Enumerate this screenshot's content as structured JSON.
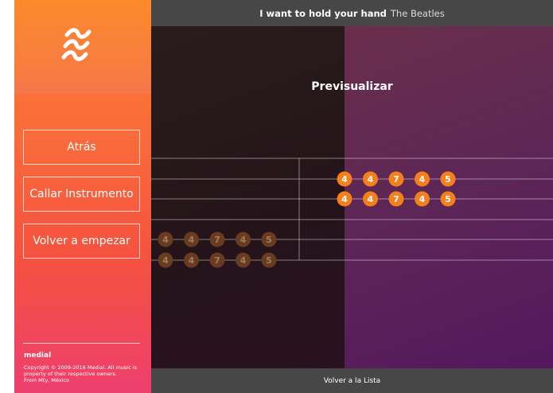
{
  "header": {
    "song_title": "I want to hold your hand",
    "artist": "The Beatles"
  },
  "sidebar": {
    "logo_icon": "waves-logo-icon",
    "buttons": [
      {
        "label": "Atrás"
      },
      {
        "label": "Callar Instrumento"
      },
      {
        "label": "Volver a empezar"
      }
    ],
    "brand": "medial",
    "copyright": "Copyright © 2009-2016 Medial. All music is property of their respective owners.",
    "location": "From Mty, México"
  },
  "stage": {
    "preview_title": "Previsualizar",
    "note_groups": [
      {
        "group": "upcoming",
        "row1": [
          "4",
          "4",
          "7",
          "4",
          "5"
        ],
        "row2": [
          "4",
          "4",
          "7",
          "4",
          "5"
        ]
      },
      {
        "group": "played",
        "row1": [
          "4",
          "4",
          "7",
          "4",
          "5"
        ],
        "row2": [
          "4",
          "4",
          "7",
          "4",
          "5"
        ]
      }
    ]
  },
  "footer": {
    "back_label": "Volver a la Lista"
  },
  "colors": {
    "note_active": "#f57f1a",
    "note_faded": "#6b3b1f",
    "header_bg": "#474747"
  }
}
